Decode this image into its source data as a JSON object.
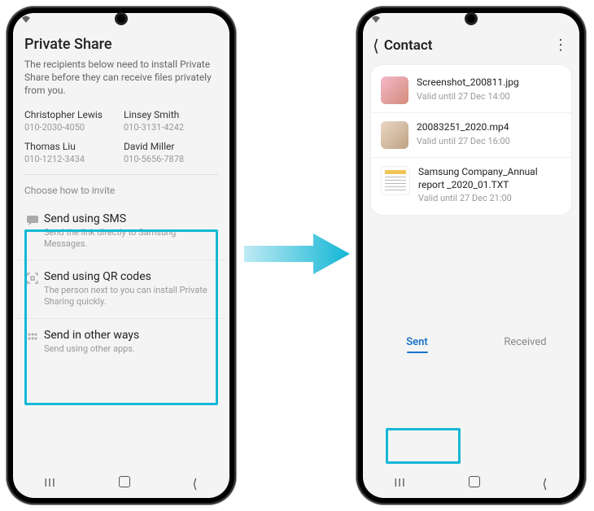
{
  "left": {
    "title": "Private Share",
    "subtitle": "The recipients below need to install Private Share before they can receive files privately from you.",
    "recipients": [
      {
        "name": "Christopher Lewis",
        "phone": "010-2030-4050"
      },
      {
        "name": "Linsey Smith",
        "phone": "010-3131-4242"
      },
      {
        "name": "Thomas Liu",
        "phone": "010-1212-3434"
      },
      {
        "name": "David Miller",
        "phone": "010-5656-7878"
      }
    ],
    "choose_label": "Choose how to invite",
    "options": [
      {
        "icon": "message-icon",
        "title": "Send using SMS",
        "sub": "Send the link directly to Samsung Messages."
      },
      {
        "icon": "qr-icon",
        "title": "Send using QR codes",
        "sub": "The person next to you can install Private Sharing quickly."
      },
      {
        "icon": "grid-icon",
        "title": "Send in other ways",
        "sub": "Send using other apps."
      }
    ]
  },
  "right": {
    "title": "Contact",
    "files": [
      {
        "name": "Screenshot_200811.jpg",
        "valid": "Valid until 27 Dec 14:00",
        "thumb": "img1"
      },
      {
        "name": "20083251_2020.mp4",
        "valid": "Valid until 27 Dec 16:00",
        "thumb": "img2"
      },
      {
        "name": "Samsung Company_Annual report _2020_01.TXT",
        "valid": "Valid until 27 Dec 21:00",
        "thumb": "doc"
      }
    ],
    "tabs": {
      "sent": "Sent",
      "received": "Received"
    }
  }
}
